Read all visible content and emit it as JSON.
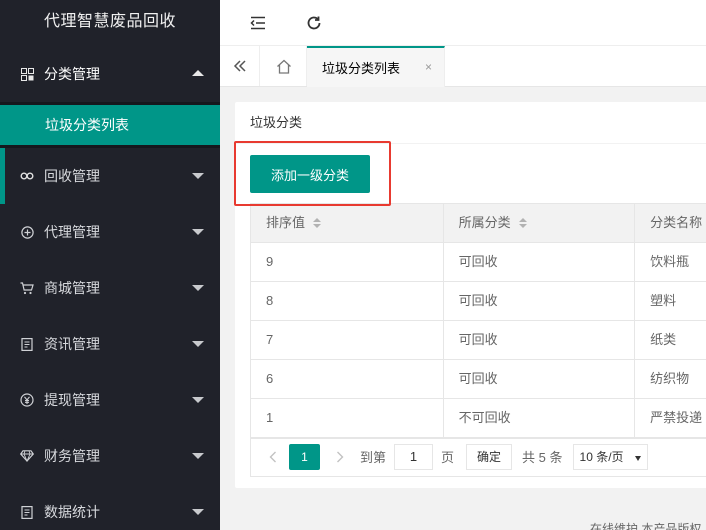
{
  "app": {
    "title": "代理智慧废品回收"
  },
  "sidebar": {
    "items": [
      {
        "label": "分类管理",
        "icon": "grid-icon",
        "open": true,
        "children": [
          {
            "label": "垃圾分类列表"
          }
        ]
      },
      {
        "label": "回收管理",
        "icon": "link-icon"
      },
      {
        "label": "代理管理",
        "icon": "plus-circle-icon"
      },
      {
        "label": "商城管理",
        "icon": "cart-icon"
      },
      {
        "label": "资讯管理",
        "icon": "doc-icon"
      },
      {
        "label": "提现管理",
        "icon": "yen-icon"
      },
      {
        "label": "财务管理",
        "icon": "diamond-icon"
      },
      {
        "label": "数据统计",
        "icon": "doc-icon"
      }
    ]
  },
  "tabs": {
    "active": {
      "label": "垃圾分类列表",
      "close": "×"
    }
  },
  "card": {
    "title": "垃圾分类",
    "add_button": "添加一级分类"
  },
  "table": {
    "headers": [
      "排序值",
      "所属分类",
      "分类名称"
    ],
    "rows": [
      [
        "9",
        "可回收",
        "饮料瓶"
      ],
      [
        "8",
        "可回收",
        "塑料"
      ],
      [
        "7",
        "可回收",
        "纸类"
      ],
      [
        "6",
        "可回收",
        "纺织物"
      ],
      [
        "1",
        "不可回收",
        "严禁投递"
      ]
    ]
  },
  "pager": {
    "current": "1",
    "goto_prefix": "到第",
    "goto_value": "1",
    "goto_suffix": "页",
    "confirm": "确定",
    "total": "共 5 条",
    "page_size": "10 条/页"
  },
  "footer": {
    "text": "在线维护   本产品版权"
  },
  "colors": {
    "accent": "#009688",
    "sidebar_bg": "#20222a",
    "highlight": "#e83a30"
  }
}
